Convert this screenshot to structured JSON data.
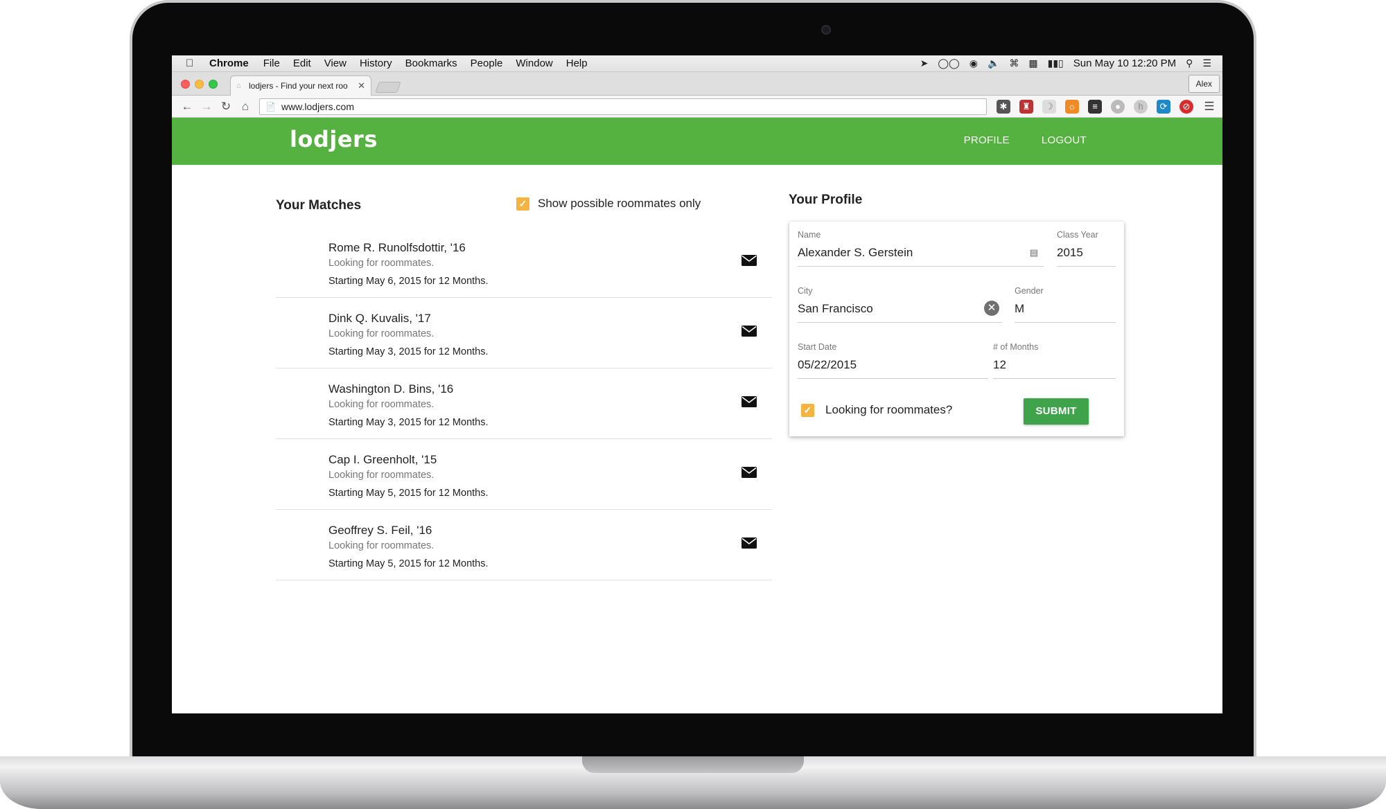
{
  "menubar": {
    "app": "Chrome",
    "items": [
      "File",
      "Edit",
      "View",
      "History",
      "Bookmarks",
      "People",
      "Window",
      "Help"
    ],
    "clock": "Sun May 10  12:20 PM"
  },
  "browser": {
    "tab_title": "lodjers - Find your next roo",
    "profile": "Alex",
    "url": "www.lodjers.com"
  },
  "site": {
    "logo": "lodjers",
    "nav": {
      "profile": "PROFILE",
      "logout": "LOGOUT"
    }
  },
  "matches": {
    "title": "Your Matches",
    "filter_label": "Show possible roommates only",
    "items": [
      {
        "name": "Rome R. Runolfsdottir, '16",
        "status": "Looking for roommates.",
        "dates": "Starting May 6, 2015 for 12 Months."
      },
      {
        "name": "Dink Q. Kuvalis, '17",
        "status": "Looking for roommates.",
        "dates": "Starting May 3, 2015 for 12 Months."
      },
      {
        "name": "Washington D. Bins, '16",
        "status": "Looking for roommates.",
        "dates": "Starting May 3, 2015 for 12 Months."
      },
      {
        "name": "Cap I. Greenholt, '15",
        "status": "Looking for roommates.",
        "dates": "Starting May 5, 2015 for 12 Months."
      },
      {
        "name": "Geoffrey S. Feil, '16",
        "status": "Looking for roommates.",
        "dates": "Starting May 5, 2015 for 12 Months."
      }
    ]
  },
  "profile": {
    "title": "Your Profile",
    "name_label": "Name",
    "name_value": "Alexander S. Gerstein",
    "class_year_label": "Class Year",
    "class_year_value": "2015",
    "city_label": "City",
    "city_value": "San Francisco",
    "gender_label": "Gender",
    "gender_value": "M",
    "start_date_label": "Start Date",
    "start_date_value": "05/22/2015",
    "months_label": "# of Months",
    "months_value": "12",
    "looking_label": "Looking for roommates?",
    "submit_label": "SUBMIT"
  },
  "colors": {
    "brand_green": "#55b140",
    "checkbox_orange": "#f5b342",
    "submit_green": "#3ea34a"
  }
}
